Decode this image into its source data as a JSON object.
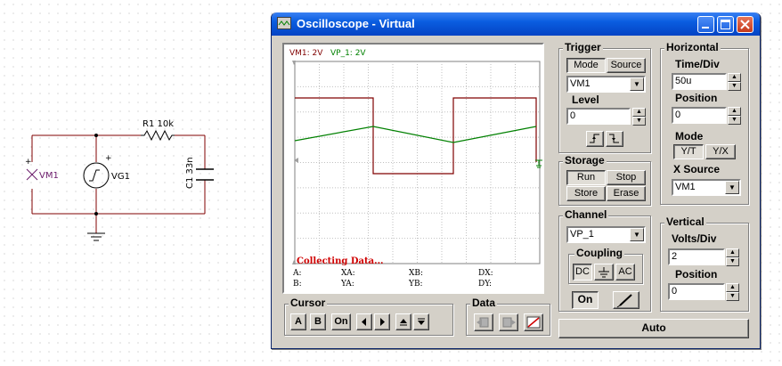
{
  "schematic": {
    "resistor_label": "R1 10k",
    "capacitor_label": "C1 33n",
    "source_label": "VG1",
    "meter_label": "VM1"
  },
  "window": {
    "title": "Oscilloscope - Virtual"
  },
  "screen": {
    "channel_legend_a": "VM1: 2V",
    "channel_legend_b": "VP_1: 2V",
    "status": "Collecting Data...",
    "readouts": {
      "a": "A:",
      "b": "B:",
      "xa": "XA:",
      "ya": "YA:",
      "xb": "XB:",
      "yb": "YB:",
      "dx": "DX:",
      "dy": "DY:"
    },
    "colors": {
      "vm1": "#800000",
      "vp1": "#008000"
    }
  },
  "trigger": {
    "title": "Trigger",
    "mode_label": "Mode",
    "source_label": "Source",
    "source_value": "VM1",
    "level_label": "Level",
    "level_value": "0"
  },
  "storage": {
    "title": "Storage",
    "run_label": "Run",
    "stop_label": "Stop",
    "store_label": "Store",
    "erase_label": "Erase"
  },
  "horizontal": {
    "title": "Horizontal",
    "timediv_label": "Time/Div",
    "timediv_value": "50u",
    "position_label": "Position",
    "position_value": "0",
    "mode_label": "Mode",
    "yt_label": "Y/T",
    "yx_label": "Y/X",
    "xsource_label": "X Source",
    "xsource_value": "VM1"
  },
  "channel": {
    "title": "Channel",
    "value": "VP_1",
    "coupling_label": "Coupling",
    "dc_label": "DC",
    "ac_label": "AC",
    "on_label": "On"
  },
  "vertical": {
    "title": "Vertical",
    "voltsdiv_label": "Volts/Div",
    "voltsdiv_value": "2",
    "position_label": "Position",
    "position_value": "0"
  },
  "cursor": {
    "title": "Cursor",
    "a_label": "A",
    "b_label": "B",
    "on_label": "On"
  },
  "data_group": {
    "title": "Data"
  },
  "auto_label": "Auto"
}
